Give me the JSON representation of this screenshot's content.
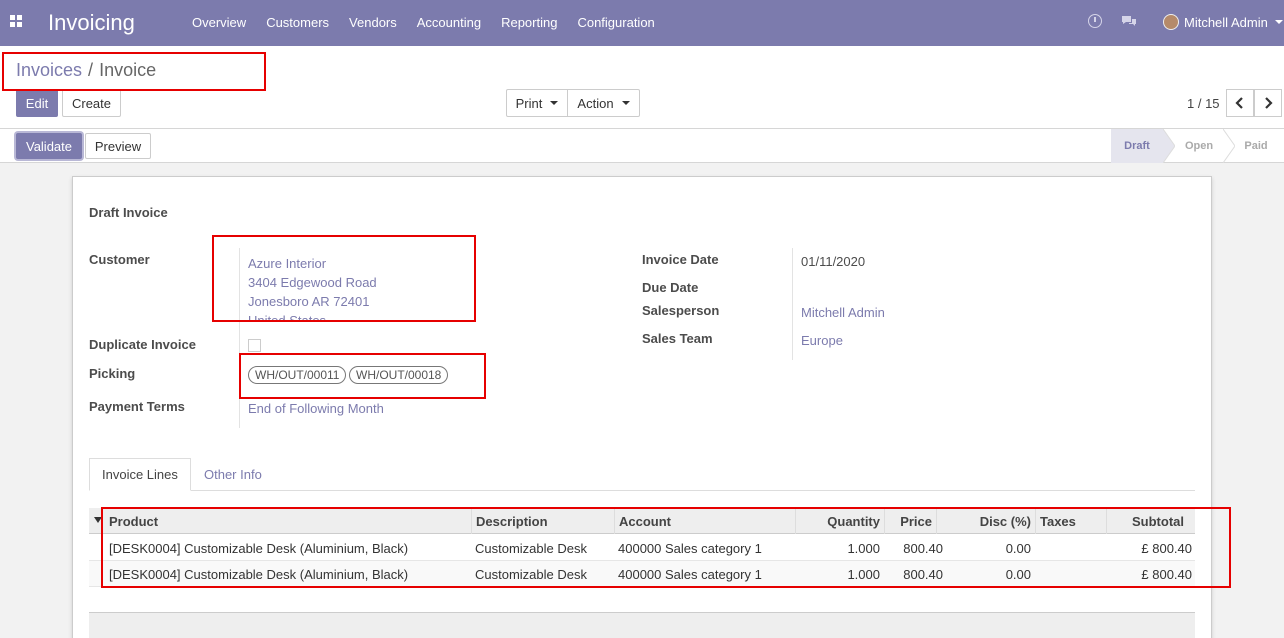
{
  "app": {
    "title": "Invoicing"
  },
  "nav": {
    "items": [
      "Overview",
      "Customers",
      "Vendors",
      "Accounting",
      "Reporting",
      "Configuration"
    ]
  },
  "user": {
    "name": "Mitchell Admin"
  },
  "breadcrumb": {
    "parent": "Invoices",
    "separator": "/",
    "current": "Invoice"
  },
  "buttons": {
    "edit": "Edit",
    "create": "Create",
    "print": "Print",
    "action": "Action",
    "validate": "Validate",
    "preview": "Preview"
  },
  "pager": {
    "value": "1 / 15"
  },
  "stages": {
    "items": [
      "Draft",
      "Open",
      "Paid"
    ],
    "active": "Draft"
  },
  "form": {
    "heading": "Draft Invoice",
    "customer_label": "Customer",
    "customer_lines": [
      "Azure Interior",
      "3404 Edgewood Road",
      "Jonesboro AR 72401",
      "United States"
    ],
    "duplicate_label": "Duplicate Invoice",
    "picking_label": "Picking",
    "pickings": [
      "WH/OUT/00011",
      "WH/OUT/00018"
    ],
    "payment_terms_label": "Payment Terms",
    "payment_terms": "End of Following Month",
    "invoice_date_label": "Invoice Date",
    "invoice_date": "01/11/2020",
    "due_date_label": "Due Date",
    "salesperson_label": "Salesperson",
    "salesperson": "Mitchell Admin",
    "sales_team_label": "Sales Team",
    "sales_team": "Europe"
  },
  "tabs": {
    "lines": "Invoice Lines",
    "other": "Other Info"
  },
  "table": {
    "columns": [
      "Product",
      "Description",
      "Account",
      "Quantity",
      "Price",
      "Disc (%)",
      "Taxes",
      "Subtotal"
    ],
    "rows": [
      [
        "[DESK0004] Customizable Desk (Aluminium, Black)",
        "Customizable Desk",
        "400000 Sales category 1",
        "1.000",
        "800.40",
        "0.00",
        "",
        "£ 800.40"
      ],
      [
        "[DESK0004] Customizable Desk (Aluminium, Black)",
        "Customizable Desk",
        "400000 Sales category 1",
        "1.000",
        "800.40",
        "0.00",
        "",
        "£ 800.40"
      ]
    ]
  },
  "colors": {
    "brand": "#7c7bad",
    "highlight": "#e60000"
  }
}
